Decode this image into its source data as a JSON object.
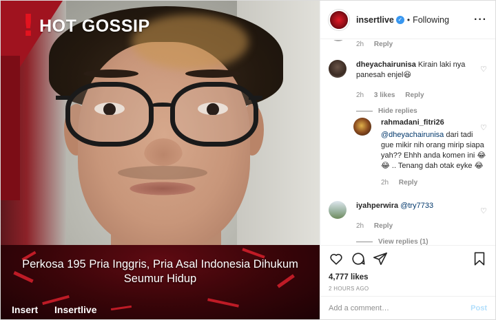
{
  "media": {
    "overlay_title": "HOT GOSSIP",
    "headline": "Perkosa 195 Pria Inggris, Pria Asal Indonesia Dihukum Seumur Hidup",
    "brand_left": "Insert",
    "brand_right": "Insertlive"
  },
  "header": {
    "username": "insertlive",
    "separator": "•",
    "follow_state": "Following",
    "more_icon": "ellipsis-icon"
  },
  "comments": {
    "top_meta": {
      "time": "2h",
      "reply": "Reply"
    },
    "items": [
      {
        "username": "dheyachairunisa",
        "text": "Kirain laki nya panesah enjel😆",
        "time": "2h",
        "likes": "3 likes",
        "reply": "Reply",
        "hide_replies": "Hide replies"
      },
      {
        "username": "rahmadani_fitri26",
        "mention": "@dheyachairunisa",
        "text": " dari tadi gue mikir nih orang mirip siapa yah?? Ehhh anda komen ini 😂😂 .. Tenang dah otak eyke 😂",
        "time": "2h",
        "reply": "Reply"
      },
      {
        "username": "iyahperwira",
        "mention": "@try7733",
        "time": "2h",
        "reply": "Reply",
        "view_replies": "View replies (1)"
      }
    ]
  },
  "actions": {
    "likes": "4,777 likes",
    "posted": "2 HOURS AGO"
  },
  "add_comment": {
    "placeholder": "Add a comment…",
    "post_label": "Post"
  },
  "colors": {
    "brand_red": "#e3131f",
    "link_blue": "#00376b",
    "verified_blue": "#3897f0",
    "post_disabled": "#b2dffc",
    "muted": "#8e8e8e"
  }
}
